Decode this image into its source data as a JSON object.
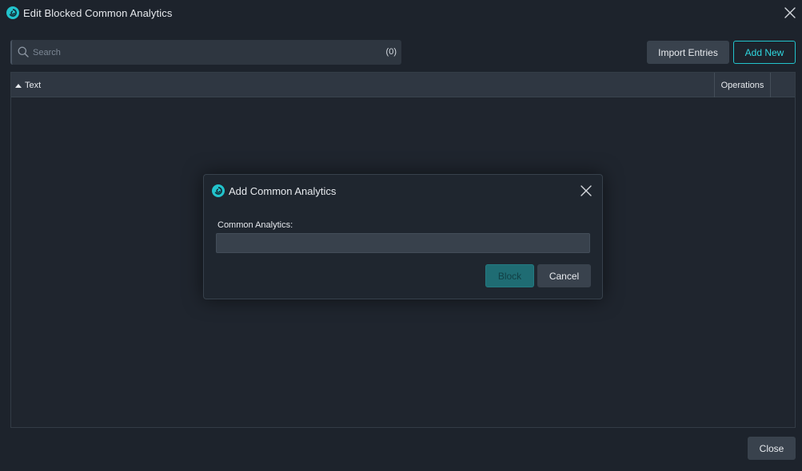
{
  "window": {
    "title": "Edit Blocked Common Analytics"
  },
  "toolbar": {
    "search_placeholder": "Search",
    "search_value": "",
    "count": "(0)",
    "import_label": "Import Entries",
    "add_new_label": "Add New"
  },
  "table": {
    "columns": [
      {
        "label": "Text",
        "sort": "ascending"
      },
      {
        "label": "Operations"
      }
    ],
    "rows": []
  },
  "footer": {
    "close_label": "Close"
  },
  "dialog": {
    "title": "Add Common Analytics",
    "field_label": "Common Analytics:",
    "field_value": "",
    "block_label": "Block",
    "cancel_label": "Cancel"
  },
  "colors": {
    "background": "#1d232c",
    "accent": "#22c3cc",
    "panel": "#2f3742",
    "button": "#39424d",
    "block_button": "#1f6c73"
  },
  "icons": {
    "app_logo": "app-logo-icon",
    "search": "search-icon",
    "close": "close-icon",
    "sort": "sort-ascending-icon"
  }
}
